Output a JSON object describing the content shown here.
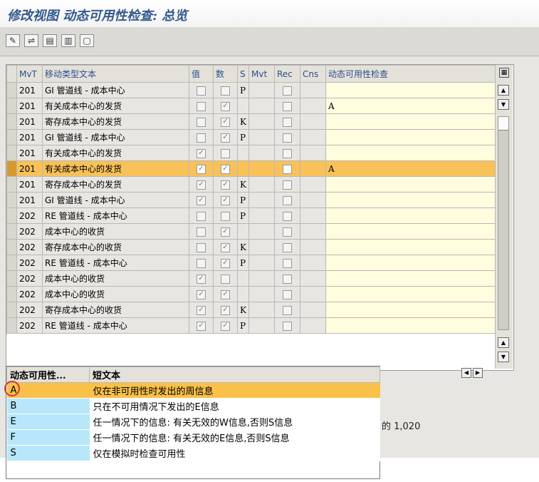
{
  "window": {
    "title": "修改视图 动态可用性检查: 总览"
  },
  "toolbar": {
    "icons": [
      "edit-icon",
      "display-change-icon",
      "select-all-icon",
      "select-block-icon",
      "deselect-icon"
    ]
  },
  "grid": {
    "headers": [
      "MvT",
      "移动类型文本",
      "值",
      "数",
      "S",
      "Mvt",
      "Rec",
      "Cns",
      "动态可用性检查"
    ],
    "rows": [
      {
        "mvt": "201",
        "text": "GI 管道线 - 成本中心",
        "val": false,
        "qty": false,
        "s": "P",
        "dyn": ""
      },
      {
        "mvt": "201",
        "text": "有关成本中心的发货",
        "val": false,
        "qty": true,
        "s": "",
        "dyn": "A"
      },
      {
        "mvt": "201",
        "text": "寄存成本中心的发货",
        "val": false,
        "qty": true,
        "s": "K",
        "dyn": ""
      },
      {
        "mvt": "201",
        "text": "GI 管道线 - 成本中心",
        "val": false,
        "qty": true,
        "s": "P",
        "dyn": ""
      },
      {
        "mvt": "201",
        "text": "有关成本中心的发货",
        "val": true,
        "qty": false,
        "s": "",
        "dyn": ""
      },
      {
        "mvt": "201",
        "text": "有关成本中心的发货",
        "val": true,
        "qty": true,
        "s": "",
        "dyn": "A"
      },
      {
        "mvt": "201",
        "text": "寄存成本中心的发货",
        "val": true,
        "qty": true,
        "s": "K",
        "dyn": ""
      },
      {
        "mvt": "201",
        "text": "GI 管道线 - 成本中心",
        "val": true,
        "qty": true,
        "s": "P",
        "dyn": ""
      },
      {
        "mvt": "202",
        "text": "RE 管道线 - 成本中心",
        "val": false,
        "qty": false,
        "s": "P",
        "dyn": ""
      },
      {
        "mvt": "202",
        "text": "成本中心的收货",
        "val": false,
        "qty": true,
        "s": "",
        "dyn": ""
      },
      {
        "mvt": "202",
        "text": "寄存成本中心的收货",
        "val": false,
        "qty": true,
        "s": "K",
        "dyn": ""
      },
      {
        "mvt": "202",
        "text": "RE 管道线 - 成本中心",
        "val": false,
        "qty": true,
        "s": "P",
        "dyn": ""
      },
      {
        "mvt": "202",
        "text": "成本中心的收货",
        "val": true,
        "qty": false,
        "s": "",
        "dyn": ""
      },
      {
        "mvt": "202",
        "text": "成本中心的收货",
        "val": true,
        "qty": true,
        "s": "",
        "dyn": ""
      },
      {
        "mvt": "202",
        "text": "寄存成本中心的收货",
        "val": true,
        "qty": true,
        "s": "K",
        "dyn": ""
      },
      {
        "mvt": "202",
        "text": "RE 管道线 - 成本中心",
        "val": true,
        "qty": true,
        "s": "P",
        "dyn": ""
      }
    ],
    "highlighted_row": 5
  },
  "status": {
    "entries_text": "的 1,020"
  },
  "popup": {
    "headers": [
      "动态可用性...",
      "短文本"
    ],
    "items": [
      {
        "code": "A",
        "text": "仅在非可用性时发出的周信息"
      },
      {
        "code": "B",
        "text": "只在不可用情况下发出的E信息"
      },
      {
        "code": "E",
        "text": "任一情况下的信息: 有关无效的W信息,否则S信息"
      },
      {
        "code": "F",
        "text": "任一情况下的信息: 有关无效的E信息,否则S信息"
      },
      {
        "code": "S",
        "text": "仅在模拟时检查可用性"
      }
    ],
    "selected": 0
  }
}
